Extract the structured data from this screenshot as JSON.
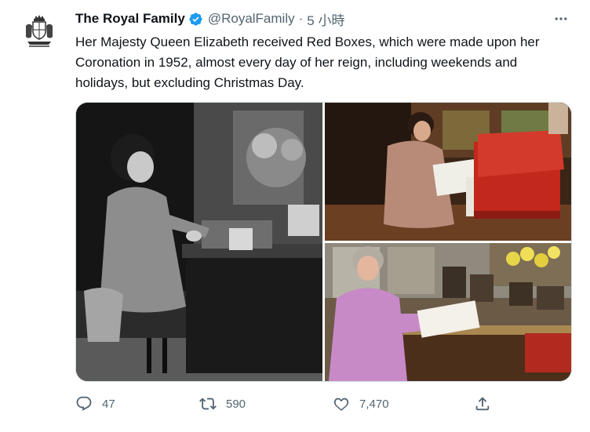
{
  "tweet": {
    "display_name": "The Royal Family",
    "handle": "@RoyalFamily",
    "separator": "·",
    "time": "5 小時",
    "text": "Her Majesty Queen Elizabeth received Red Boxes, which were made upon her Coronation in 1952, almost every day of her reign, including weekends and holidays, but excluding Christmas Day."
  },
  "icons": {
    "avatar": "royal-coat-of-arms",
    "verified": "verified-badge-icon",
    "more": "more-icon",
    "reply": "reply-icon",
    "retweet": "retweet-icon",
    "like": "heart-icon",
    "share": "share-icon"
  },
  "actions": {
    "replies": "47",
    "retweets": "590",
    "likes": "7,470"
  },
  "colors": {
    "verified": "#1d9bf0",
    "secondary_text": "#536471",
    "primary_text": "#0f1419",
    "border": "#cfd9de"
  }
}
